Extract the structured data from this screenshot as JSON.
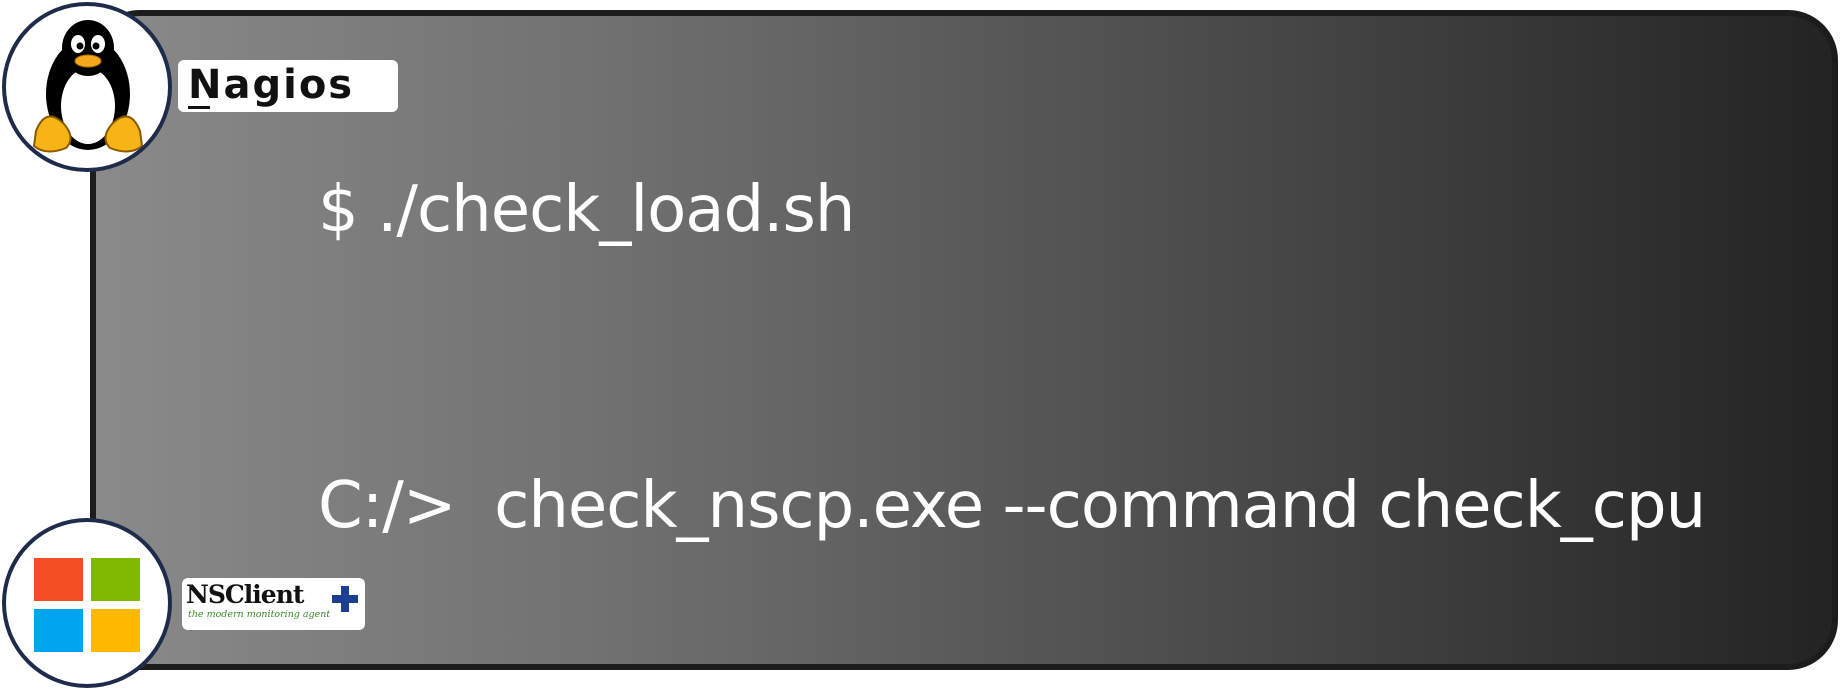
{
  "commands": {
    "linux": "$ ./check_load.sh",
    "windows": "C:/>  check_nscp.exe --command check_cpu"
  },
  "logos": {
    "nagios": "Nagios",
    "nsclient_name": "NSClient",
    "nsclient_tagline": "the modern monitoring agent"
  },
  "icons": {
    "linux": "tux-penguin-icon",
    "windows": "windows-logo-icon",
    "nsclient_plus": "plus-icon"
  },
  "colors": {
    "windows_red": "#f25022",
    "windows_green": "#7fba00",
    "windows_blue": "#00a4ef",
    "windows_yellow": "#ffb900",
    "nsclient_plus": "#1c3f94",
    "circle_border": "#1e2b4a"
  }
}
